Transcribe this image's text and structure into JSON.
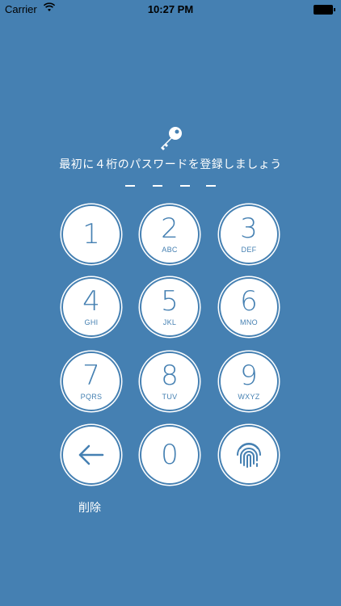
{
  "status_bar": {
    "carrier": "Carrier",
    "time": "10:27 PM"
  },
  "prompt": "最初に４桁のパスワードを登録しましょう",
  "keypad": {
    "keys": [
      {
        "digit": "1",
        "letters": ""
      },
      {
        "digit": "2",
        "letters": "ABC"
      },
      {
        "digit": "3",
        "letters": "DEF"
      },
      {
        "digit": "4",
        "letters": "GHI"
      },
      {
        "digit": "5",
        "letters": "JKL"
      },
      {
        "digit": "6",
        "letters": "MNO"
      },
      {
        "digit": "7",
        "letters": "PQRS"
      },
      {
        "digit": "8",
        "letters": "TUV"
      },
      {
        "digit": "9",
        "letters": "WXYZ"
      },
      {
        "digit": "0",
        "letters": ""
      }
    ],
    "back_icon": "left-arrow-icon",
    "fingerprint_icon": "fingerprint-icon",
    "delete_label": "削除"
  },
  "colors": {
    "background": "#4580b2",
    "key": "#ffffff",
    "accent": "#4580b2"
  }
}
